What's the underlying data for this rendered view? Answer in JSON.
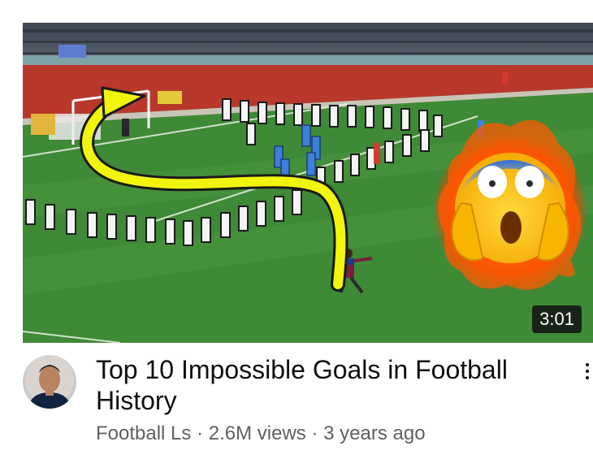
{
  "video": {
    "duration": "3:01",
    "title": "Top 10 Impossible Goals in Football History",
    "channel": "Football Ls",
    "separator": "·",
    "views": "2.6M views",
    "age": "3 years ago"
  },
  "icons": {
    "more": "vertical-ellipsis-icon",
    "avatar": "channel-avatar",
    "emoji": "shocked-face-emoji-icon"
  },
  "colors": {
    "title": "#0f0f0f",
    "meta": "#606060",
    "pitch": "#3f8a36",
    "arrow": "#f1f50d",
    "duration_bg": "#141414"
  }
}
